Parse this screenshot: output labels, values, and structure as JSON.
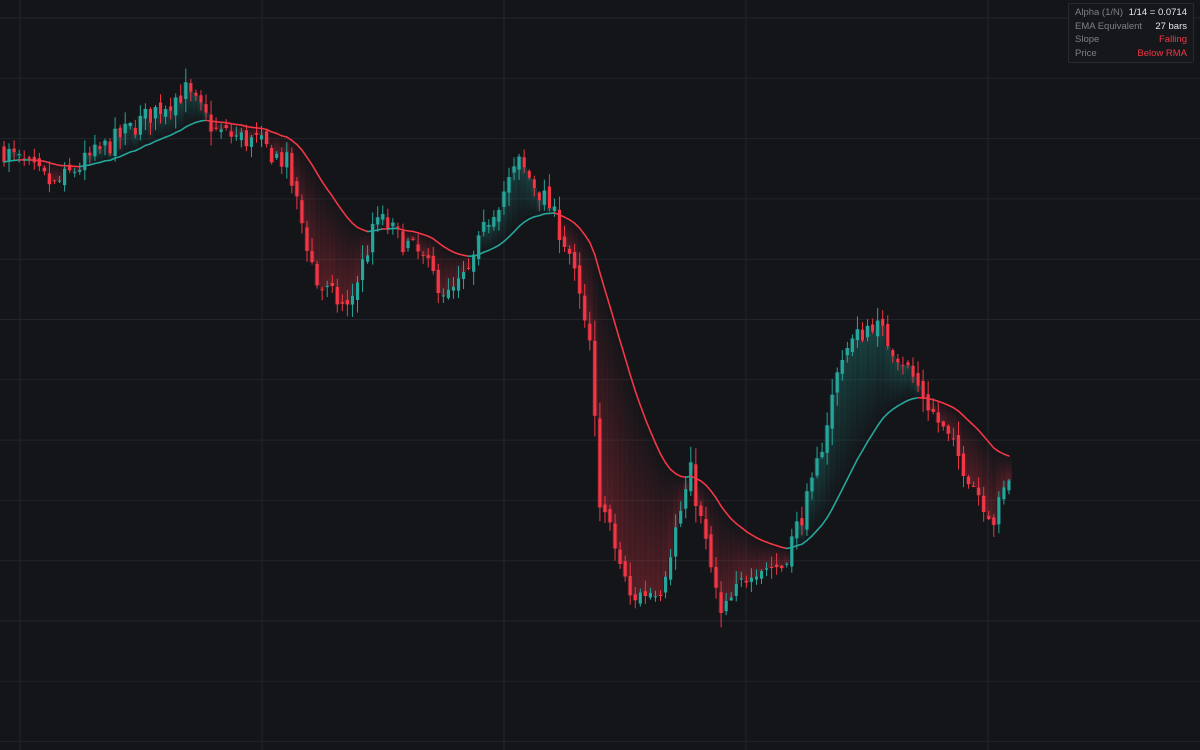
{
  "colors": {
    "background": "#131519",
    "grid": "#22252b",
    "up": "#26a69a",
    "down": "#f23645",
    "rma_falling": "#f23645",
    "rma_rising": "#26a69a"
  },
  "info_panel": {
    "rows": [
      {
        "label": "Alpha (1/N)",
        "value": "1/14 = 0.0714",
        "tone": "neutral"
      },
      {
        "label": "EMA Equivalent",
        "value": "27 bars",
        "tone": "neutral"
      },
      {
        "label": "Slope",
        "value": "Falling",
        "tone": "negative"
      },
      {
        "label": "Price",
        "value": "Below RMA",
        "tone": "negative"
      }
    ]
  },
  "chart_data": {
    "type": "candlestick",
    "title": "",
    "xlabel": "",
    "ylabel": "",
    "grid": true,
    "indicator": {
      "name": "RMA",
      "period": 14
    },
    "ylim": [
      0,
      100
    ],
    "bar_count": 200,
    "trajectory_anchors": [
      {
        "bar": 0,
        "close": 81.6
      },
      {
        "bar": 10,
        "close": 76.6
      },
      {
        "bar": 16,
        "close": 80.0
      },
      {
        "bar": 22,
        "close": 83.1
      },
      {
        "bar": 30,
        "close": 87.3
      },
      {
        "bar": 36,
        "close": 90.0
      },
      {
        "bar": 42,
        "close": 84.3
      },
      {
        "bar": 50,
        "close": 82.8
      },
      {
        "bar": 56,
        "close": 79.8
      },
      {
        "bar": 62,
        "close": 62.9
      },
      {
        "bar": 68,
        "close": 59.2
      },
      {
        "bar": 74,
        "close": 72.1
      },
      {
        "bar": 82,
        "close": 67.0
      },
      {
        "bar": 88,
        "close": 61.0
      },
      {
        "bar": 92,
        "close": 64.3
      },
      {
        "bar": 96,
        "close": 72.1
      },
      {
        "bar": 102,
        "close": 79.8
      },
      {
        "bar": 108,
        "close": 73.8
      },
      {
        "bar": 112,
        "close": 67.2
      },
      {
        "bar": 116,
        "close": 53.7
      },
      {
        "bar": 118,
        "close": 32.8
      },
      {
        "bar": 124,
        "close": 18.6
      },
      {
        "bar": 130,
        "close": 20.2
      },
      {
        "bar": 136,
        "close": 36.2
      },
      {
        "bar": 142,
        "close": 15.9
      },
      {
        "bar": 148,
        "close": 22.9
      },
      {
        "bar": 154,
        "close": 23.1
      },
      {
        "bar": 160,
        "close": 34.0
      },
      {
        "bar": 166,
        "close": 53.2
      },
      {
        "bar": 172,
        "close": 57.5
      },
      {
        "bar": 178,
        "close": 52.1
      },
      {
        "bar": 184,
        "close": 44.6
      },
      {
        "bar": 190,
        "close": 37.2
      },
      {
        "bar": 196,
        "close": 29.6
      },
      {
        "bar": 199,
        "close": 35.5
      }
    ]
  }
}
